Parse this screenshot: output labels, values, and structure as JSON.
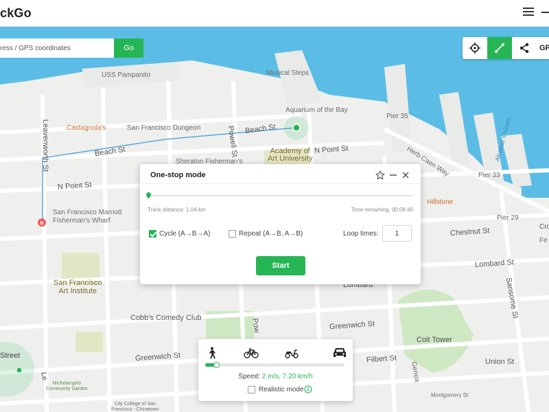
{
  "app": {
    "title": "ckGo"
  },
  "search": {
    "placeholder": "ress / GPS coordinates",
    "go_label": "Go"
  },
  "toolbar": {
    "gps_label": "GP"
  },
  "map_labels": {
    "musical_steps": "Musical Steps",
    "uss_pampanito": "USS Pampanito",
    "aquarium": "Aquarium of the Bay",
    "pier35": "Pier 35",
    "pier33": "Pier 33",
    "alcatraz": "Alcatraz Cruises",
    "herb_caen": "Herb Caen Way",
    "castagnola": "Castagnola's",
    "sf_dungeon": "San Francisco Dungeon",
    "beach_st_1": "Beach St",
    "beach_st_2": "Beach St",
    "powell_st": "Powell St",
    "leavenworth_st": "Leavenworth St",
    "academy": "Academy of\nArt University",
    "n_point_st_1": "N Point St",
    "n_point_st_2": "N Point St",
    "sheraton": "Sheraton Fisherman's",
    "marriott": "San Francisco Marriott\nFisherman's Wharf",
    "hillstone": "Hillstone",
    "chestnut_st": "Chestnut St",
    "pier29": "Pier 29",
    "lombard_st_1": "Lombard St",
    "lombard_st_2": "Lombard",
    "sansome_st": "Sansome St",
    "sf_art_institute": "San Francisco\nArt Institute",
    "cobbs": "Cobb's Comedy Club",
    "greenwich_st_1": "Greenwich St",
    "greenwich_st_2": "Greenwich St",
    "coit_tower": "Coit Tower",
    "filbert_st": "Filbert St",
    "genoa": "Genoa",
    "union_st": "Union St",
    "street_partial": "Street",
    "mcdonald_park": "Michelangelo\nCommunity Garden",
    "city_college": "City College of San\nFrancisco - Chinatown",
    "cro_partial": "Cro",
    "fe_partial": "Fe",
    "pow_partial": "Pow",
    "le_partial": "Le",
    "montgomery": "Montgomery St"
  },
  "dialog": {
    "title": "One-stop mode",
    "track_distance": "Track distance: 1.04 km",
    "time_remaining": "Time remaining: 00:08:40",
    "cycle_label": "Cycle (A→B→A)",
    "cycle_checked": true,
    "repeat_label": "Repeat (A→B, A→B)",
    "repeat_checked": false,
    "loop_label": "Loop times:",
    "loop_value": "1",
    "start_label": "Start"
  },
  "speed_panel": {
    "speed_label": "Speed:",
    "speed_value": "2 m/s, 7.20 km/h",
    "speed_fraction": 0.08,
    "realistic_label": "Realistic mode",
    "realistic_checked": false
  },
  "markers": {
    "start_marker": "B"
  },
  "colors": {
    "accent": "#26b555",
    "water": "#5bbde6",
    "route": "#5aa7de"
  },
  "icons": [
    "menu-icon",
    "minimize-icon",
    "locate-icon",
    "route-icon",
    "share-icon",
    "star-icon",
    "minus-icon",
    "close-icon",
    "walk-icon",
    "bike-icon",
    "scooter-icon",
    "car-icon",
    "info-icon"
  ]
}
